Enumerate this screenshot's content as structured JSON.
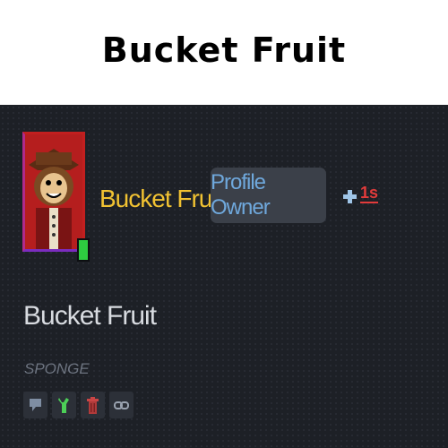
{
  "caption": {
    "title": "Bucket Fruit"
  },
  "profile": {
    "username": "Bucket Fruit",
    "badge_label": "Profile Owner",
    "timer": "1s",
    "display_name": "Bucket Fruit",
    "role": "SPONGE"
  },
  "icons": {
    "avatar": "avatar-image",
    "status": "online-status-icon",
    "plus": "plus-icon",
    "actions": [
      "message-icon",
      "wrench-icon",
      "trash-icon",
      "link-icon"
    ]
  },
  "colors": {
    "panel_background": "#1d2026",
    "username": "#f1c232",
    "badge_background": "#3b4049",
    "badge_text": "#6fa8dc",
    "timer": "#e23b3b",
    "status_online": "#2ecc40",
    "display_name": "#d8dbe0",
    "role": "#6d7480"
  }
}
